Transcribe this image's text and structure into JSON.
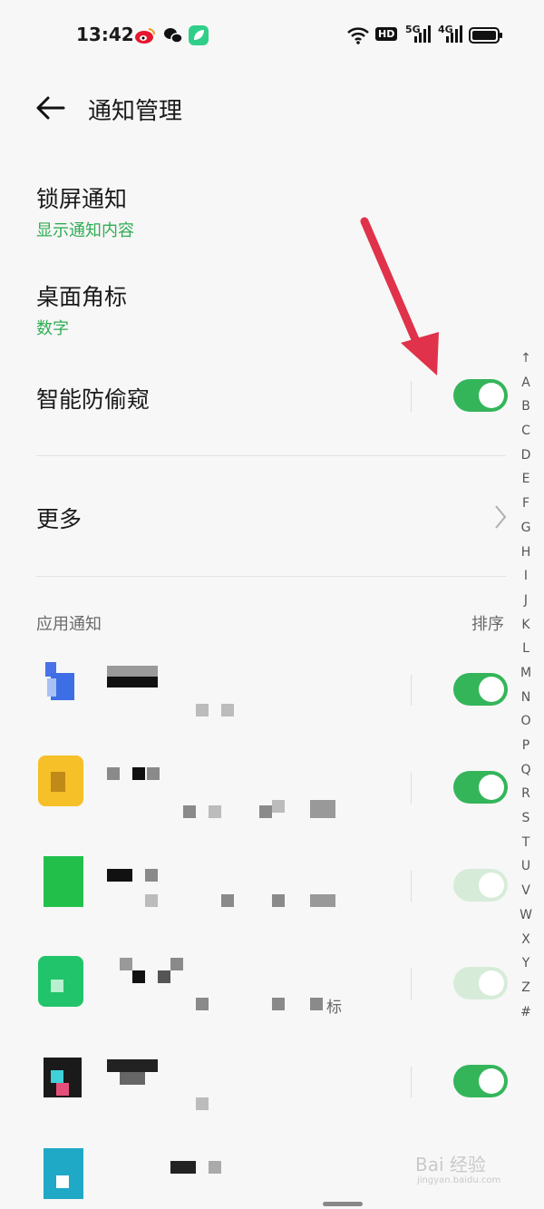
{
  "status_bar": {
    "time": "13:42",
    "hd_label": "HD",
    "net1": "5G",
    "net2": "4G"
  },
  "header": {
    "title": "通知管理"
  },
  "settings": {
    "lock_screen": {
      "title": "锁屏通知",
      "value": "显示通知内容"
    },
    "badge": {
      "title": "桌面角标",
      "value": "数字"
    },
    "anti_peek": {
      "title": "智能防偷窥",
      "enabled": true
    },
    "more": {
      "title": "更多"
    }
  },
  "app_section": {
    "label": "应用通知",
    "sort_label": "排序"
  },
  "apps": [
    {
      "enabled": true
    },
    {
      "enabled": true
    },
    {
      "enabled": true,
      "faded": true
    },
    {
      "enabled": true,
      "faded": true,
      "badge_char": "标"
    },
    {
      "enabled": true
    },
    {}
  ],
  "index_letters": [
    "↑",
    "A",
    "B",
    "C",
    "D",
    "E",
    "F",
    "G",
    "H",
    "I",
    "J",
    "K",
    "L",
    "M",
    "N",
    "O",
    "P",
    "Q",
    "R",
    "S",
    "T",
    "U",
    "V",
    "W",
    "X",
    "Y",
    "Z",
    "#"
  ],
  "watermark": {
    "main": "Bai 经验",
    "sub": "jingyan.baidu.com"
  },
  "colors": {
    "accent": "#34b55a",
    "subtext_green": "#2fae53",
    "annotation_arrow": "#e0324a"
  },
  "icons": [
    "weibo-icon",
    "wechat-icon",
    "leaf-app-icon",
    "wifi-icon",
    "signal-icon",
    "battery-icon",
    "back-arrow-icon",
    "chevron-right-icon"
  ]
}
